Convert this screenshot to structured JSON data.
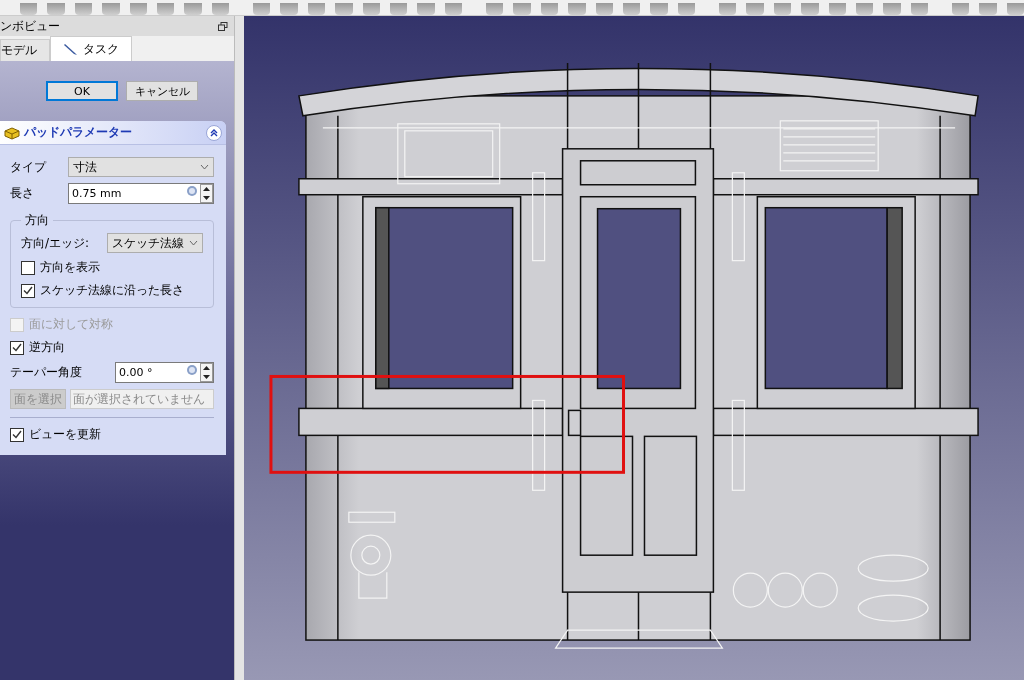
{
  "combo_view": {
    "title": "ンボビュー",
    "tabs": [
      {
        "label": "モデル",
        "selected": false
      },
      {
        "label": "タスク",
        "selected": true
      }
    ]
  },
  "dialog_buttons": [
    {
      "label": "OK",
      "default": true
    },
    {
      "label": "キャンセル",
      "default": false
    }
  ],
  "pad_parameters": {
    "title": "パッドパラメーター",
    "expanded": true,
    "type": {
      "label": "タイプ",
      "value": "寸法"
    },
    "length": {
      "label": "長さ",
      "value": "0.75 mm"
    },
    "direction": {
      "title": "方向",
      "edge_label": "方向/エッジ:",
      "edge_value": "スケッチ法線",
      "options": [
        {
          "label": "方向を表示",
          "checked": false
        },
        {
          "label": "スケッチ法線に沿った長さ",
          "checked": true
        }
      ]
    },
    "options": [
      {
        "label": "面に対して対称",
        "checked": false,
        "disabled": true
      },
      {
        "label": "逆方向",
        "checked": true,
        "disabled": false
      }
    ],
    "taper": {
      "label": "テーパー角度",
      "value": "0.00 °"
    },
    "face": {
      "button": "面を選択",
      "placeholder": "面が選択されていません",
      "disabled": true
    },
    "update_view": {
      "label": "ビューを更新",
      "checked": true
    }
  }
}
